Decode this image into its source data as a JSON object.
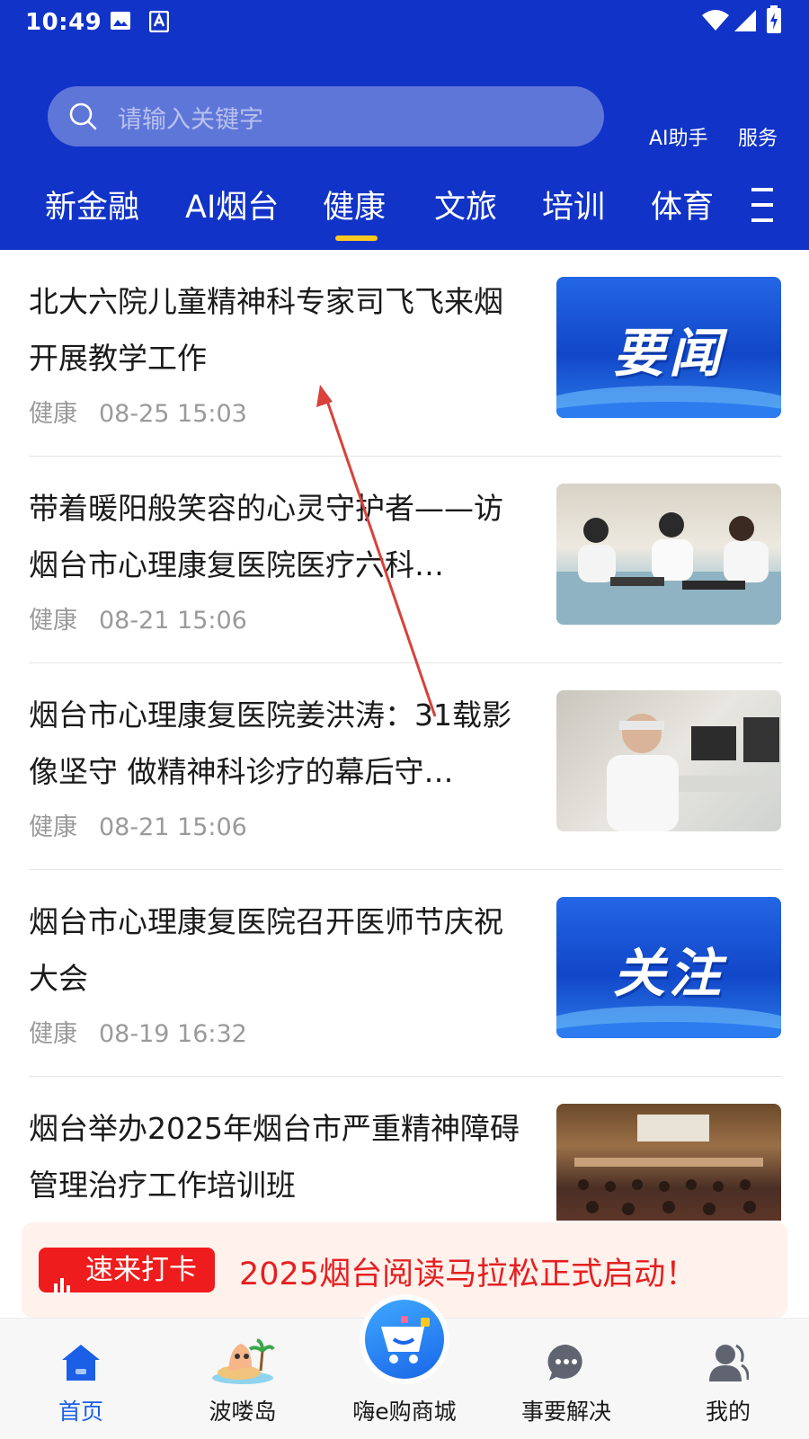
{
  "status_bar": {
    "time": "10:49"
  },
  "header": {
    "search_placeholder": "请输入关键字",
    "ai_assistant": "AI助手",
    "service": "服务",
    "tabs": [
      "新金融",
      "AI烟台",
      "健康",
      "文旅",
      "培训",
      "体育"
    ],
    "active_tab": "健康"
  },
  "news": [
    {
      "title": "北大六院儿童精神科专家司飞飞来烟开展教学工作",
      "category": "健康",
      "time": "08-25 15:03",
      "thumb_text": "要闻"
    },
    {
      "title": "带着暖阳般笑容的心灵守护者——访烟台市心理康复医院医疗六科…",
      "category": "健康",
      "time": "08-21 15:06"
    },
    {
      "title": "烟台市心理康复医院姜洪涛：31载影像坚守 做精神科诊疗的幕后守…",
      "category": "健康",
      "time": "08-21 15:06"
    },
    {
      "title": "烟台市心理康复医院召开医师节庆祝大会",
      "category": "健康",
      "time": "08-19 16:32",
      "thumb_text": "关注"
    },
    {
      "title": "烟台举办2025年烟台市严重精神障碍 管理治疗工作培训班"
    }
  ],
  "banner": {
    "tag": "速来打卡",
    "text": "2025烟台阅读马拉松正式启动！"
  },
  "bottom_nav": [
    "首页",
    "波喽岛",
    "嗨e购商城",
    "事要解决",
    "我的"
  ],
  "colors": {
    "header_bg": "#1133c7",
    "tab_indicator": "#ffc81f",
    "nav_active": "#1a5fe6",
    "banner_red": "#e52020"
  }
}
